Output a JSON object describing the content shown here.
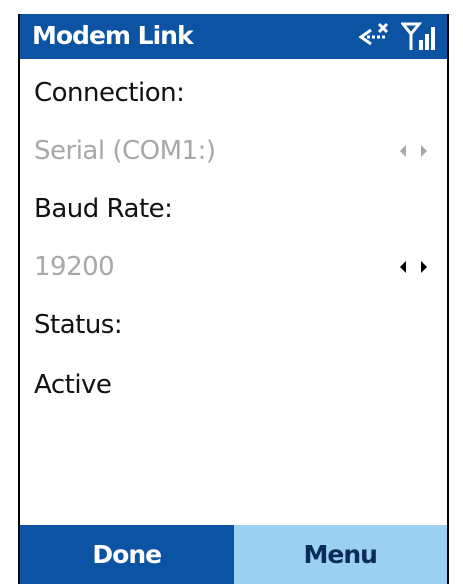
{
  "window": {
    "title": "Modem Link",
    "title_bar_color": "#0c54a3",
    "status_icons": [
      "connection-off-icon",
      "signal-strength-icon"
    ]
  },
  "form": {
    "connection_label": "Connection:",
    "connection_value": "Serial (COM1:)",
    "baud_rate_label": "Baud Rate:",
    "baud_rate_value": "19200",
    "status_label": "Status:",
    "status_value": "Active"
  },
  "softkeys": {
    "left_label": "Done",
    "right_label": "Menu",
    "left_color": "#0c54a3",
    "right_color": "#9cd0f0"
  }
}
